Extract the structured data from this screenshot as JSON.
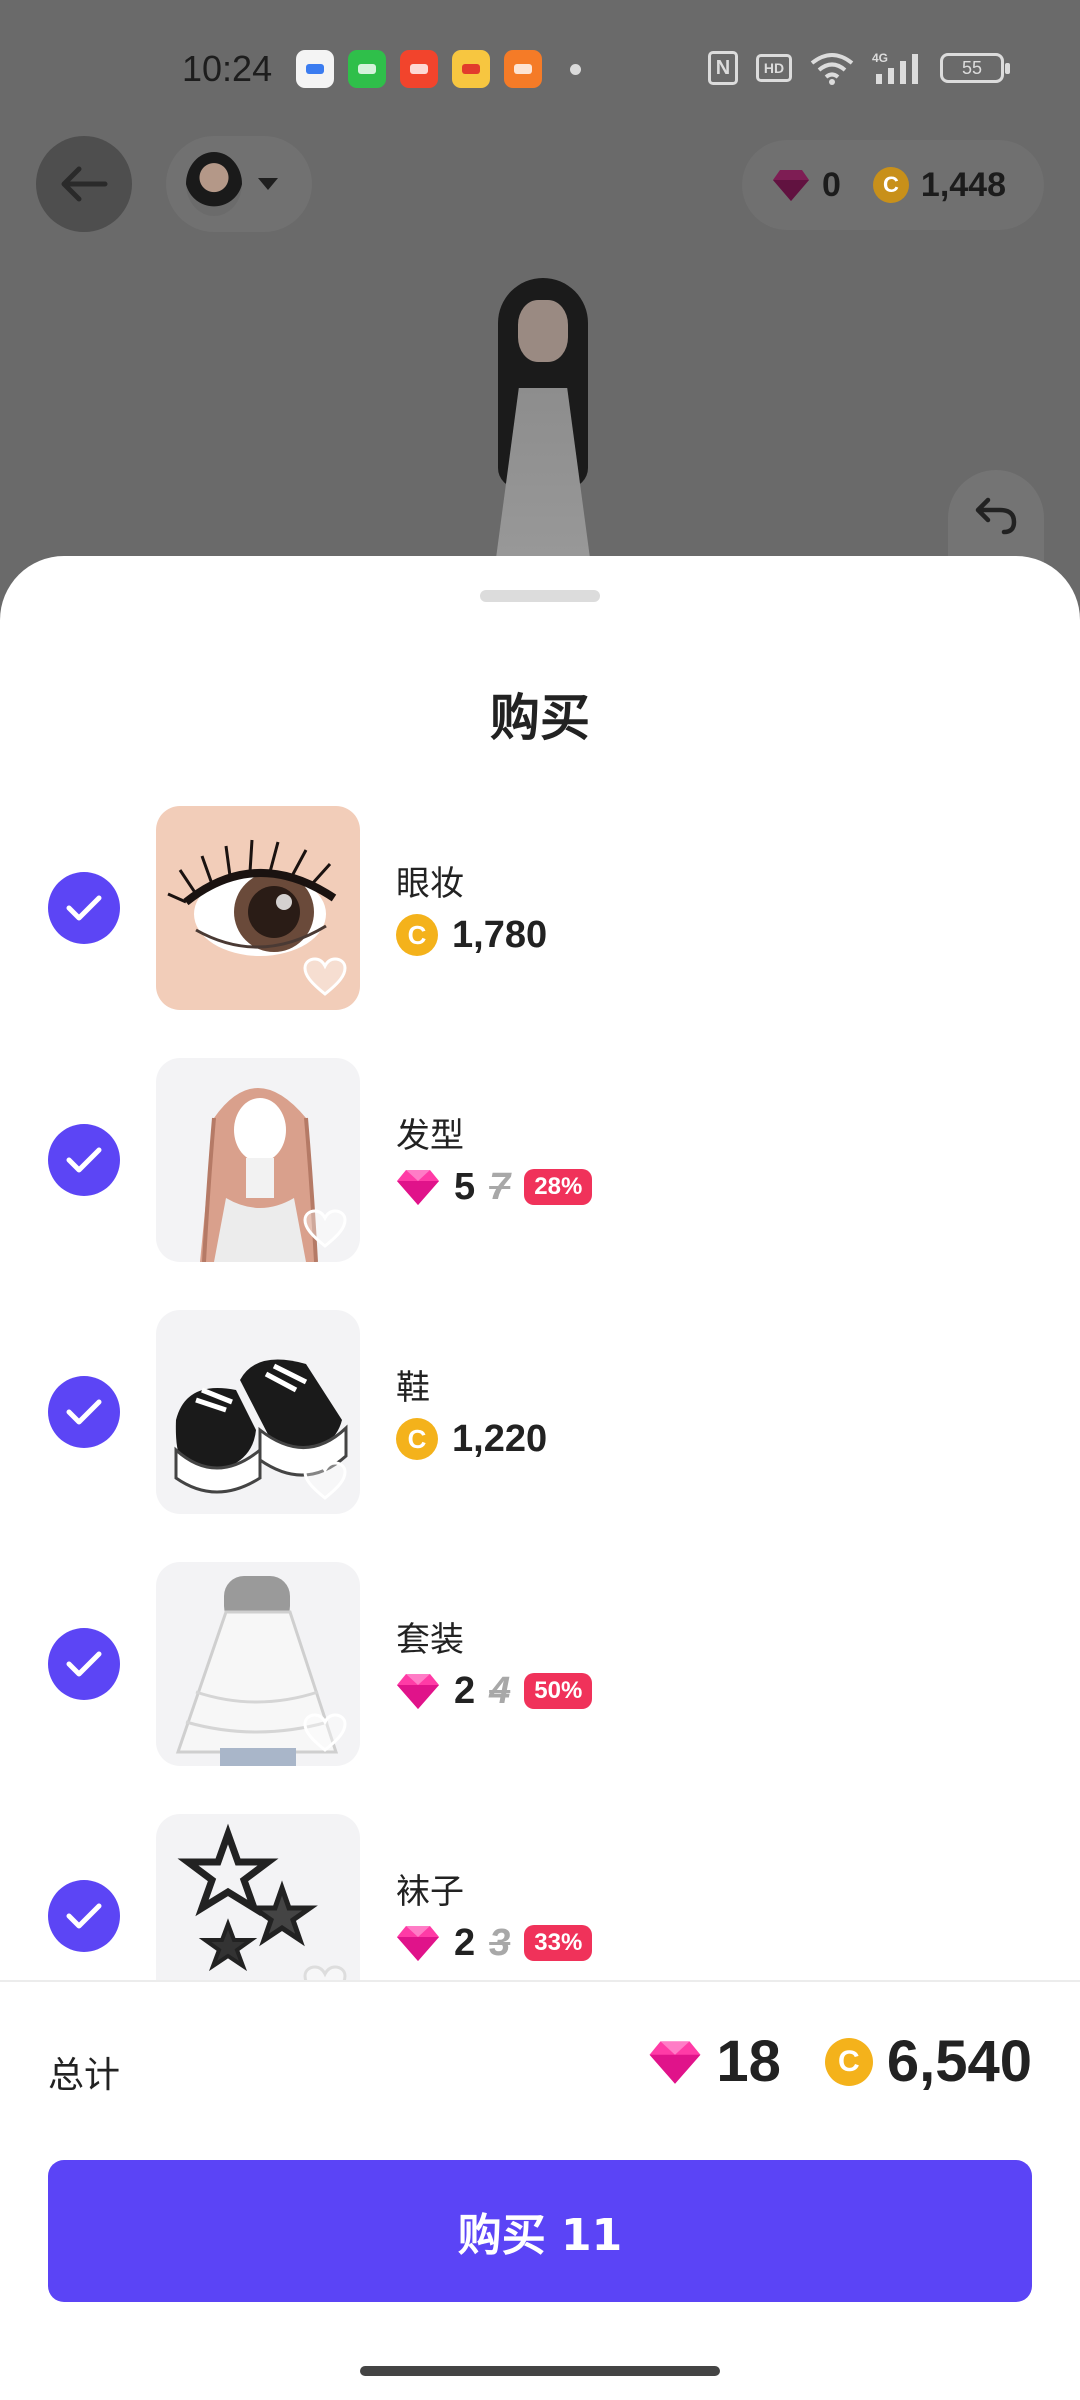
{
  "status_bar": {
    "time": "10:24",
    "apps": [
      {
        "icon": "wallet-app-icon",
        "color": "#ffffff"
      },
      {
        "icon": "green-app-icon",
        "color": "#2fbf4a"
      },
      {
        "icon": "video-app-icon",
        "color": "#f2442c"
      },
      {
        "icon": "weibo-app-icon",
        "color": "#f7c640"
      },
      {
        "icon": "orange-app-icon",
        "color": "#f57b27"
      }
    ],
    "nfc_label": "N",
    "hd_label": "HD",
    "network_label": "4G",
    "battery": "55"
  },
  "header": {
    "diamond_balance": "0",
    "coin_balance": "1,448"
  },
  "sheet": {
    "title": "购买",
    "items": [
      {
        "name": "眼妆",
        "currency": "coin",
        "price": "1,780",
        "old_price": "",
        "discount": ""
      },
      {
        "name": "发型",
        "currency": "diamond",
        "price": "5",
        "old_price": "7",
        "discount": "28%"
      },
      {
        "name": "鞋",
        "currency": "coin",
        "price": "1,220",
        "old_price": "",
        "discount": ""
      },
      {
        "name": "套装",
        "currency": "diamond",
        "price": "2",
        "old_price": "4",
        "discount": "50%"
      },
      {
        "name": "袜子",
        "currency": "diamond",
        "price": "2",
        "old_price": "3",
        "discount": "33%"
      }
    ],
    "total_label": "总计",
    "total_diamonds": "18",
    "total_coins": "6,540",
    "buy_label": "购买 11"
  },
  "colors": {
    "accent": "#5b44f6",
    "coin": "#f4b21b",
    "diamond": "#ff2d9b",
    "discount": "#f0325a"
  }
}
